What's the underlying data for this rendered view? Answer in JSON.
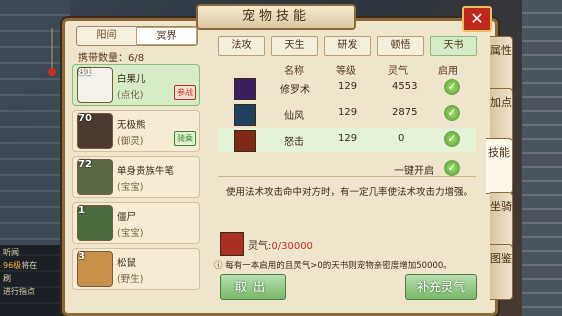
{
  "title": "宠物技能",
  "world_tabs": [
    "阳间",
    "冥界"
  ],
  "carry": {
    "label": "携带数量：",
    "value": "6/8"
  },
  "pets": [
    {
      "level": "81",
      "name": "白果儿",
      "type": "(点化)",
      "badge": "参战"
    },
    {
      "level": "70",
      "name": "无极熊",
      "type": "(御灵)",
      "badge": "骑乘"
    },
    {
      "level": "72",
      "name": "单身贵族牛笔",
      "type": "(宝宝)"
    },
    {
      "level": "1",
      "name": "僵尸",
      "type": "(宝宝)"
    },
    {
      "level": "3",
      "name": "松鼠",
      "type": "(野生)"
    }
  ],
  "skill_tabs": [
    "法攻",
    "天生",
    "研发",
    "顿悟",
    "天书"
  ],
  "table": {
    "headers": [
      "名称",
      "等级",
      "灵气",
      "启用"
    ],
    "rows": [
      {
        "name": "修罗术",
        "level": "129",
        "lingqi": "4553"
      },
      {
        "name": "仙风",
        "level": "129",
        "lingqi": "2875"
      },
      {
        "name": "怒击",
        "level": "129",
        "lingqi": "0"
      }
    ],
    "one_key": "一键开启"
  },
  "description": "使用法术攻击命中对方时，有一定几率使法术攻击力增强。",
  "lingqi": {
    "label": "灵气:",
    "value": "0/30000"
  },
  "notice": "每有一本启用的且灵气>0的天书则宠物亲密度增加50000。",
  "buttons": {
    "exit": "取出",
    "refill": "补充灵气"
  },
  "side_tabs": [
    "属性",
    "加点",
    "技能",
    "坐骑",
    "图鉴"
  ],
  "chat": [
    {
      "tag": "",
      "text": "听闻"
    },
    {
      "tag": "96级",
      "text": "将在"
    },
    {
      "tag": "",
      "text": "刷"
    },
    {
      "text": "进行指点"
    }
  ]
}
